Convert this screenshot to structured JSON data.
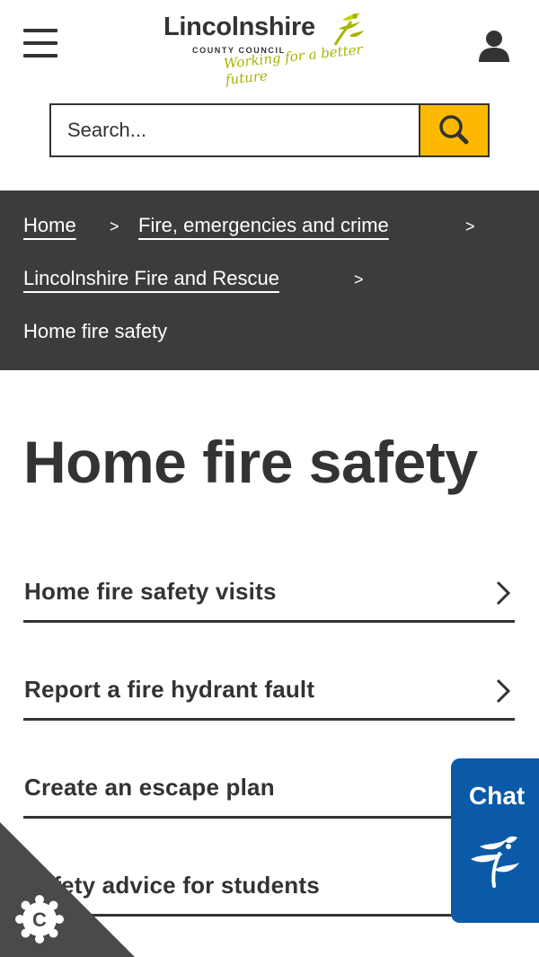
{
  "header": {
    "menu_icon": "hamburger-menu-icon",
    "logo": {
      "name": "Lincolnshire",
      "sub": "COUNTY COUNCIL",
      "tagline": "Working for a better future"
    },
    "account_icon": "user-icon"
  },
  "search": {
    "placeholder": "Search...",
    "button_icon": "search-icon",
    "button_color": "#fcb900"
  },
  "breadcrumb": {
    "items": [
      {
        "label": "Home"
      },
      {
        "label": "Fire, emergencies and crime"
      },
      {
        "label": "Lincolnshire Fire and Rescue"
      }
    ],
    "separator": ">",
    "current": "Home fire safety",
    "background": "#3c3c3b"
  },
  "page": {
    "title": "Home fire safety",
    "links": [
      {
        "label": "Home fire safety visits",
        "icon": "chevron-right-icon"
      },
      {
        "label": "Report a fire hydrant fault",
        "icon": "chevron-right-icon"
      },
      {
        "label": "Create an escape plan",
        "icon": "chevron-right-icon"
      },
      {
        "label": "Safety advice for students",
        "icon": "chevron-right-icon"
      }
    ]
  },
  "chat": {
    "label": "Chat",
    "icon": "lcc-sprig-icon",
    "color": "#0a5aa8"
  },
  "cookie": {
    "icon": "cookie-settings-icon",
    "letter": "C"
  }
}
